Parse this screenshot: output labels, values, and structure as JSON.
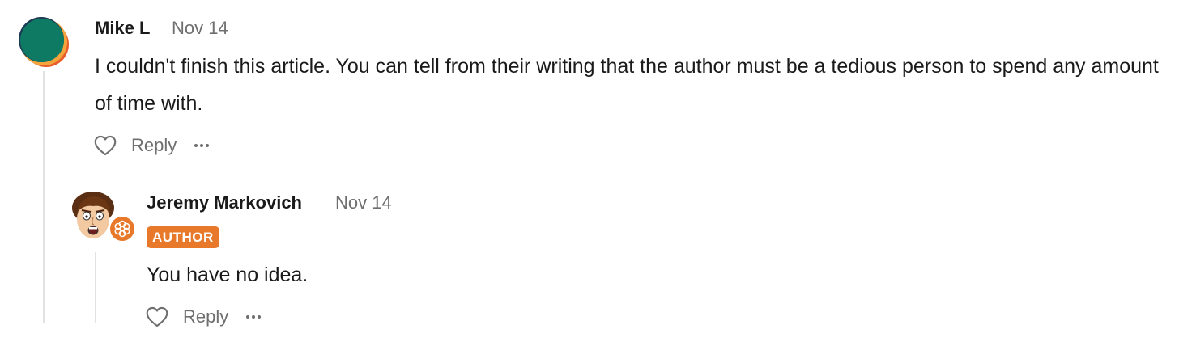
{
  "comments": [
    {
      "author": "Mike L",
      "date": "Nov 14",
      "body": "I couldn't finish this article. You can tell from their writing that the author must be a tedious person to spend any amount of time with.",
      "avatar_icon": "multicolor-circle-avatar",
      "actions": {
        "like_icon": "heart-outline-icon",
        "reply_label": "Reply",
        "more_icon": "ellipsis-icon"
      },
      "replies": [
        {
          "author": "Jeremy Markovich",
          "date": "Nov 14",
          "badge": "AUTHOR",
          "body": "You have no idea.",
          "avatar_icon": "cartoon-face-avatar",
          "publication_icon": "flower-badge-icon",
          "actions": {
            "like_icon": "heart-outline-icon",
            "reply_label": "Reply",
            "more_icon": "ellipsis-icon"
          }
        }
      ]
    }
  ],
  "colors": {
    "author_badge": "#e8792b",
    "muted_text": "#6f6f6f",
    "thread_line": "#e2e2e2"
  }
}
